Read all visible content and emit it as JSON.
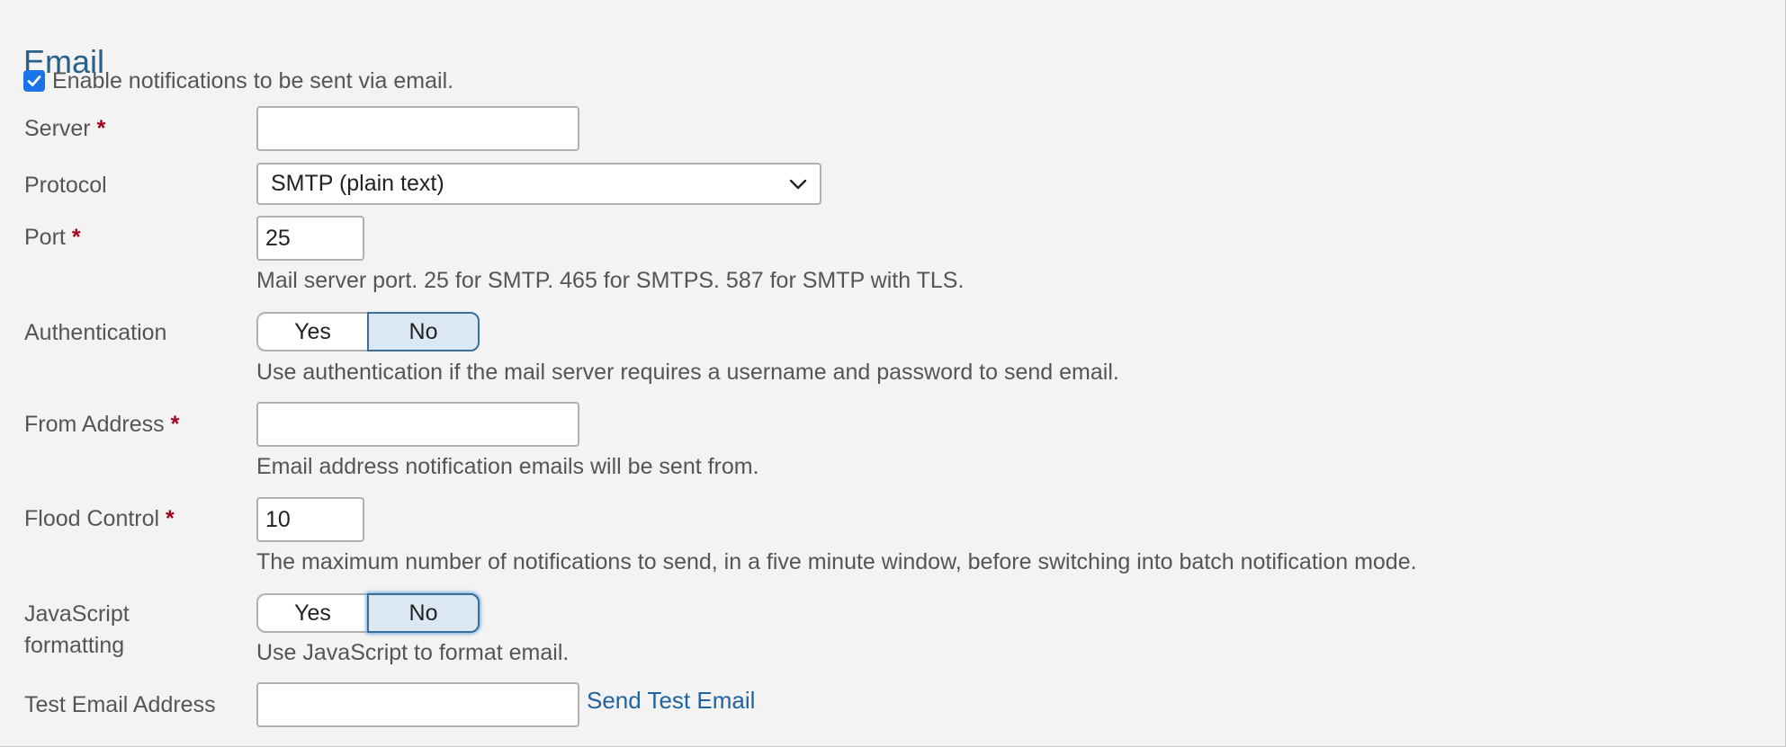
{
  "section": {
    "title": "Email"
  },
  "enable": {
    "checked": true,
    "label": "Enable notifications to be sent via email."
  },
  "fields": {
    "server": {
      "label": "Server",
      "required": "*",
      "value": ""
    },
    "protocol": {
      "label": "Protocol",
      "value": "SMTP (plain text)"
    },
    "port": {
      "label": "Port",
      "required": "*",
      "value": "25",
      "help": "Mail server port. 25 for SMTP. 465 for SMTPS. 587 for SMTP with TLS."
    },
    "authentication": {
      "label": "Authentication",
      "yes": "Yes",
      "no": "No",
      "selected": "No",
      "help": "Use authentication if the mail server requires a username and password to send email."
    },
    "from_address": {
      "label": "From Address",
      "required": "*",
      "value": "",
      "help": "Email address notification emails will be sent from."
    },
    "flood_control": {
      "label": "Flood Control",
      "required": "*",
      "value": "10",
      "help": "The maximum number of notifications to send, in a five minute window, before switching into batch notification mode."
    },
    "javascript_formatting": {
      "label_line1": "JavaScript",
      "label_line2": "formatting",
      "yes": "Yes",
      "no": "No",
      "selected": "No",
      "help": "Use JavaScript to format email."
    },
    "test_email": {
      "label": "Test Email Address",
      "value": "",
      "send_link": "Send Test Email"
    }
  },
  "colors": {
    "title": "#2a5f86",
    "required": "#a3001b",
    "link": "#1f63a0",
    "checkbox": "#1a73e8",
    "toggle_selected_bg": "#dbe8f3",
    "toggle_selected_border": "#3a6f9a"
  },
  "icons": {
    "checkbox": "checkmark-icon",
    "select": "chevron-down-icon"
  }
}
